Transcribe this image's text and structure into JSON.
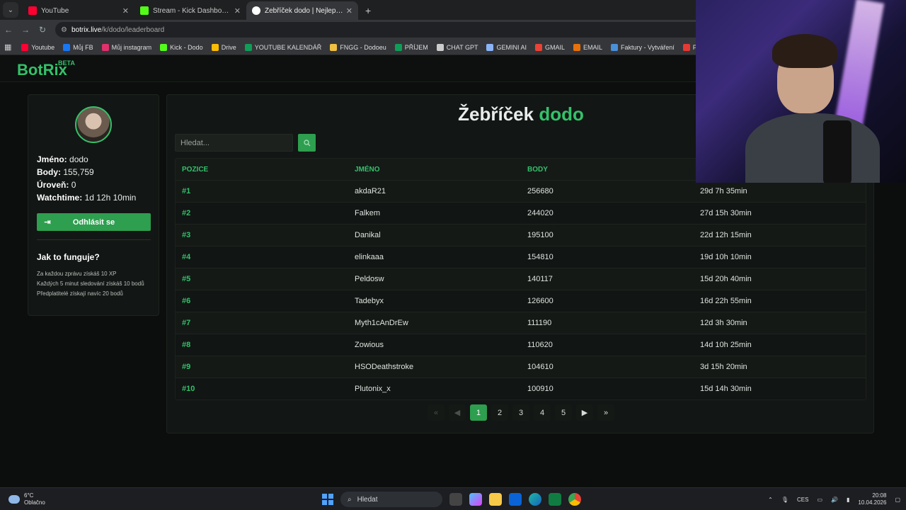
{
  "browser": {
    "tabs": [
      {
        "title": "YouTube",
        "color": "#ff0033"
      },
      {
        "title": "Stream - Kick Dashboard",
        "color": "#53fc18"
      },
      {
        "title": "Žebříček dodo | Nejlepší softw",
        "color": "#ffffff"
      }
    ],
    "url_site": "botrix.live",
    "url_path": "/k/dodo/leaderboard",
    "bookmarks": [
      {
        "label": "Youtube",
        "color": "#ff0033"
      },
      {
        "label": "Můj FB",
        "color": "#1877f2"
      },
      {
        "label": "Můj instagram",
        "color": "#e1306c"
      },
      {
        "label": "Kick - Dodo",
        "color": "#53fc18"
      },
      {
        "label": "Drive",
        "color": "#fbbc04"
      },
      {
        "label": "YOUTUBE KALENDÁŘ",
        "color": "#0f9d58"
      },
      {
        "label": "FNGG - Dodoeu",
        "color": "#f0c040"
      },
      {
        "label": "PŘÍJEM",
        "color": "#0f9d58"
      },
      {
        "label": "CHAT GPT",
        "color": "#cccccc"
      },
      {
        "label": "GEMINI AI",
        "color": "#8ab4f8"
      },
      {
        "label": "GMAIL",
        "color": "#ea4335"
      },
      {
        "label": "EMAIL",
        "color": "#e8710a"
      },
      {
        "label": "Faktury - Vytváření",
        "color": "#4a90d9"
      },
      {
        "label": "PNG to PDF",
        "color": "#e53935"
      }
    ]
  },
  "site": {
    "logo": "BotRix",
    "beta": "BETA"
  },
  "profile": {
    "name_label": "Jméno:",
    "name": "dodo",
    "points_label": "Body:",
    "points": "155,759",
    "level_label": "Úroveň:",
    "level": "0",
    "watch_label": "Watchtime:",
    "watch": "1d 12h 10min",
    "logout": "Odhlásit se",
    "how_title": "Jak to funguje?",
    "how_lines": [
      "Za každou zprávu získáš 10 XP",
      "Každých 5 minut sledování získáš 10 bodů",
      "Předplatitelé získají navíc 20 bodů"
    ]
  },
  "leaderboard": {
    "title_main": "Žebříček",
    "title_user": "dodo",
    "search_placeholder": "Hledat...",
    "columns": [
      "POZICE",
      "JMÉNO",
      "BODY"
    ],
    "rows": [
      {
        "pos": "#1",
        "name": "akdaR21",
        "points": "256680",
        "time": "29d 7h 35min"
      },
      {
        "pos": "#2",
        "name": "Falkem",
        "points": "244020",
        "time": "27d 15h 30min"
      },
      {
        "pos": "#3",
        "name": "Danikal",
        "points": "195100",
        "time": "22d 12h 15min"
      },
      {
        "pos": "#4",
        "name": "elinkaaa",
        "points": "154810",
        "time": "19d 10h 10min"
      },
      {
        "pos": "#5",
        "name": "Peldosw",
        "points": "140117",
        "time": "15d 20h 40min"
      },
      {
        "pos": "#6",
        "name": "Tadebyx",
        "points": "126600",
        "time": "16d 22h 55min"
      },
      {
        "pos": "#7",
        "name": "Myth1cAnDrEw",
        "points": "111190",
        "time": "12d 3h 30min"
      },
      {
        "pos": "#8",
        "name": "Zowious",
        "points": "110620",
        "time": "14d 10h 25min"
      },
      {
        "pos": "#9",
        "name": "HSODeathstroke",
        "points": "104610",
        "time": "3d 15h 20min"
      },
      {
        "pos": "#10",
        "name": "Plutonix_x",
        "points": "100910",
        "time": "15d 14h 30min"
      }
    ],
    "pages": [
      "1",
      "2",
      "3",
      "4",
      "5"
    ],
    "first": "«",
    "last": "»"
  },
  "taskbar": {
    "temp": "6°C",
    "weather": "Oblačno",
    "search": "Hledat",
    "lang": "CES",
    "time": "20:08",
    "date": "10.04.2026"
  }
}
